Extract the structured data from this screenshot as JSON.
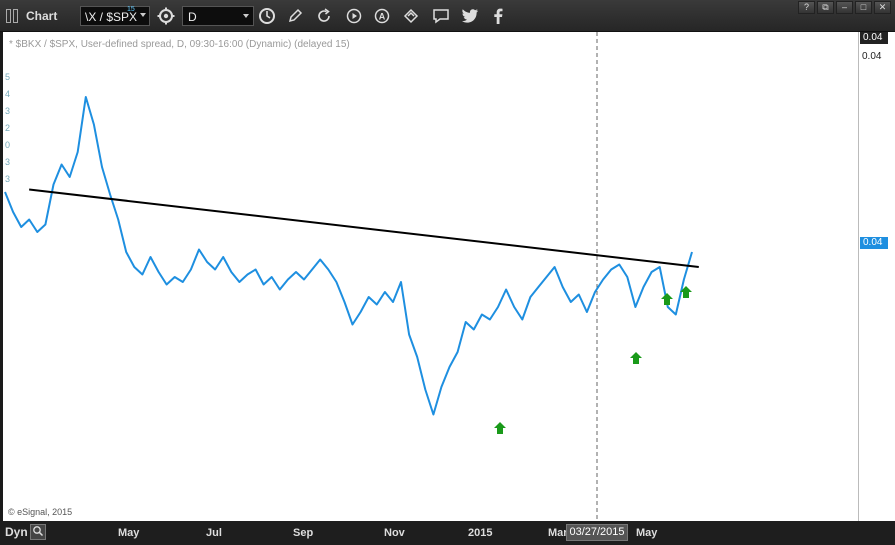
{
  "window": {
    "title": "Chart",
    "symbol": "\\X / $SPX",
    "symbol_superscript": "15",
    "interval": "D",
    "window_buttons": [
      "?",
      "⧉",
      "–",
      "□",
      "✕"
    ]
  },
  "toolbar": {
    "icons": [
      "gear-icon",
      "clock-icon",
      "pencil-icon",
      "refresh-icon",
      "play-icon",
      "alert-icon",
      "link-icon",
      "comment-icon",
      "twitter-icon",
      "facebook-icon"
    ]
  },
  "chart": {
    "legend": "* $BKX / $SPX, User-defined spread, D, 09:30-16:00 (Dynamic) (delayed 15)",
    "copyright": "© eSignal, 2015",
    "left_edge_labels": [
      "5",
      "4",
      "3",
      "2",
      "0",
      "3",
      "3"
    ]
  },
  "axis": {
    "y_top_badge": "0.04",
    "y_top_tick": "0.04",
    "y_price_badge": "0.04",
    "dyn_label": "Dyn",
    "cursor_date": "03/27/2015",
    "x_ticks": [
      "May",
      "Jul",
      "Sep",
      "Nov",
      "2015",
      "Mar",
      "May"
    ]
  },
  "colors": {
    "line": "#1e8fe0",
    "trendline": "#000000",
    "arrow": "#1a9a1a",
    "price_badge": "#1e8fe0"
  },
  "chart_data": {
    "type": "line",
    "series": [
      {
        "values": [
          0.0392,
          0.0384,
          0.0378,
          0.0381,
          0.0376,
          0.0379,
          0.0395,
          0.0403,
          0.0398,
          0.0408,
          0.043,
          0.0419,
          0.0402,
          0.0391,
          0.0381,
          0.0368,
          0.0362,
          0.0359,
          0.0366,
          0.036,
          0.0355,
          0.0358,
          0.0356,
          0.0361,
          0.0369,
          0.0364,
          0.0361,
          0.0366,
          0.036,
          0.0356,
          0.0359,
          0.0361,
          0.0355,
          0.0358,
          0.0353,
          0.0357,
          0.036,
          0.0357,
          0.0361,
          0.0365,
          0.0361,
          0.0356,
          0.0348,
          0.0339,
          0.0344,
          0.035,
          0.0347,
          0.0352,
          0.0348,
          0.0356,
          0.0335,
          0.0326,
          0.0313,
          0.0303,
          0.0314,
          0.0322,
          0.0328,
          0.034,
          0.0337,
          0.0343,
          0.0341,
          0.0346,
          0.0353,
          0.0346,
          0.0341,
          0.035,
          0.0354,
          0.0358,
          0.0362,
          0.0354,
          0.0348,
          0.0351,
          0.0344,
          0.0352,
          0.0357,
          0.0361,
          0.0363,
          0.0358,
          0.0346,
          0.0354,
          0.036,
          0.0362,
          0.0346,
          0.0343,
          0.0357,
          0.0368
        ]
      }
    ],
    "trendline": {
      "start": {
        "date": "2014-04-25",
        "value": 0.0393
      },
      "end": {
        "date": "2015-06-15",
        "value": 0.0362
      }
    },
    "signals": {
      "type": "up-arrow",
      "count": 4
    },
    "cursor_date": "03/27/2015",
    "x_ticks": [
      "May",
      "Jul",
      "Sep",
      "Nov",
      "2015",
      "Mar",
      "May"
    ],
    "y_labels": [
      "0.04"
    ],
    "grid": false
  }
}
